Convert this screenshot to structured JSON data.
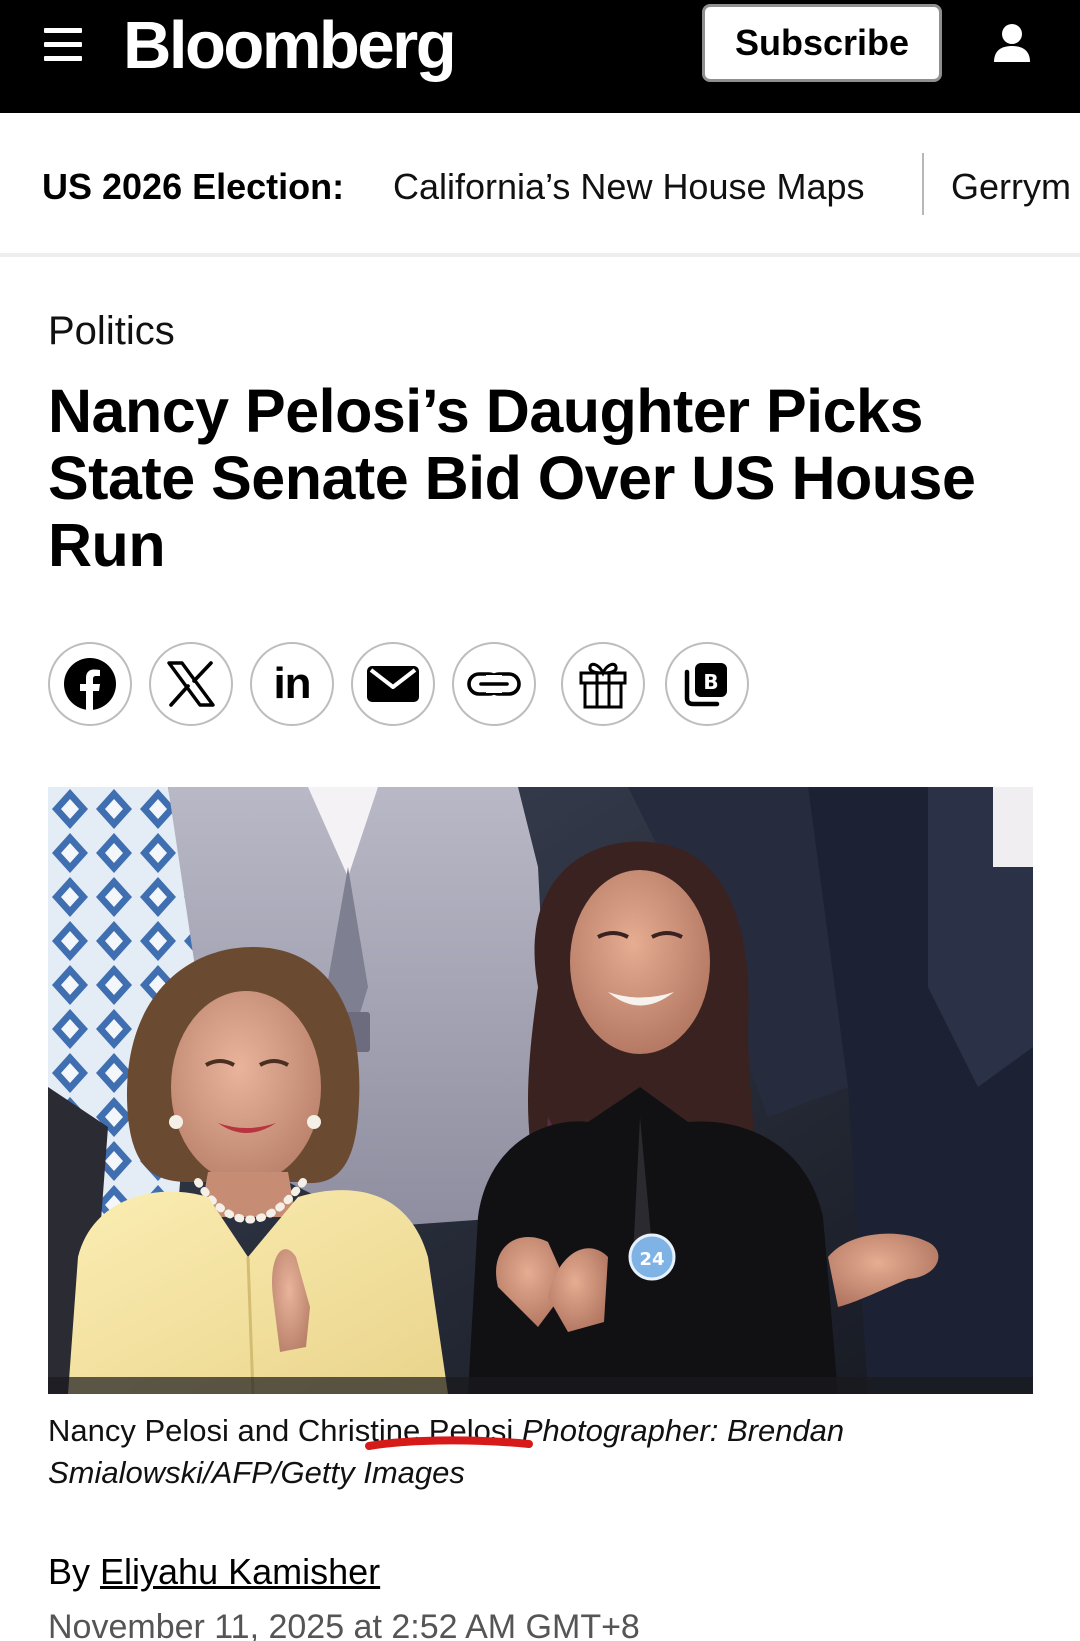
{
  "header": {
    "logo": "Bloomberg",
    "subscribe_label": "Subscribe",
    "background": "#000000"
  },
  "election_bar": {
    "label": "US 2026 Election:",
    "links": [
      "California’s New House Maps",
      "Gerrym"
    ]
  },
  "article": {
    "section": "Politics",
    "headline": "Nancy Pelosi’s Daughter Picks State Senate Bid Over US House Run",
    "share_icons": [
      "facebook-icon",
      "x-icon",
      "linkedin-icon",
      "email-icon",
      "link-icon",
      "gift-icon",
      "bloomberg-b-icon"
    ],
    "linkedin_text": "in",
    "photo_badge": "24",
    "caption": "Nancy Pelosi and Christine Pelosi",
    "credit": "Photographer: Brendan Smialowski/AFP/Getty Images",
    "byline_prefix": "By",
    "author": "Eliyahu Kamisher",
    "timestamp": "November 11, 2025 at 2:52 AM GMT+8"
  },
  "colors": {
    "annotation_red": "#d61a1a",
    "border_gray": "#bdbdbd"
  }
}
